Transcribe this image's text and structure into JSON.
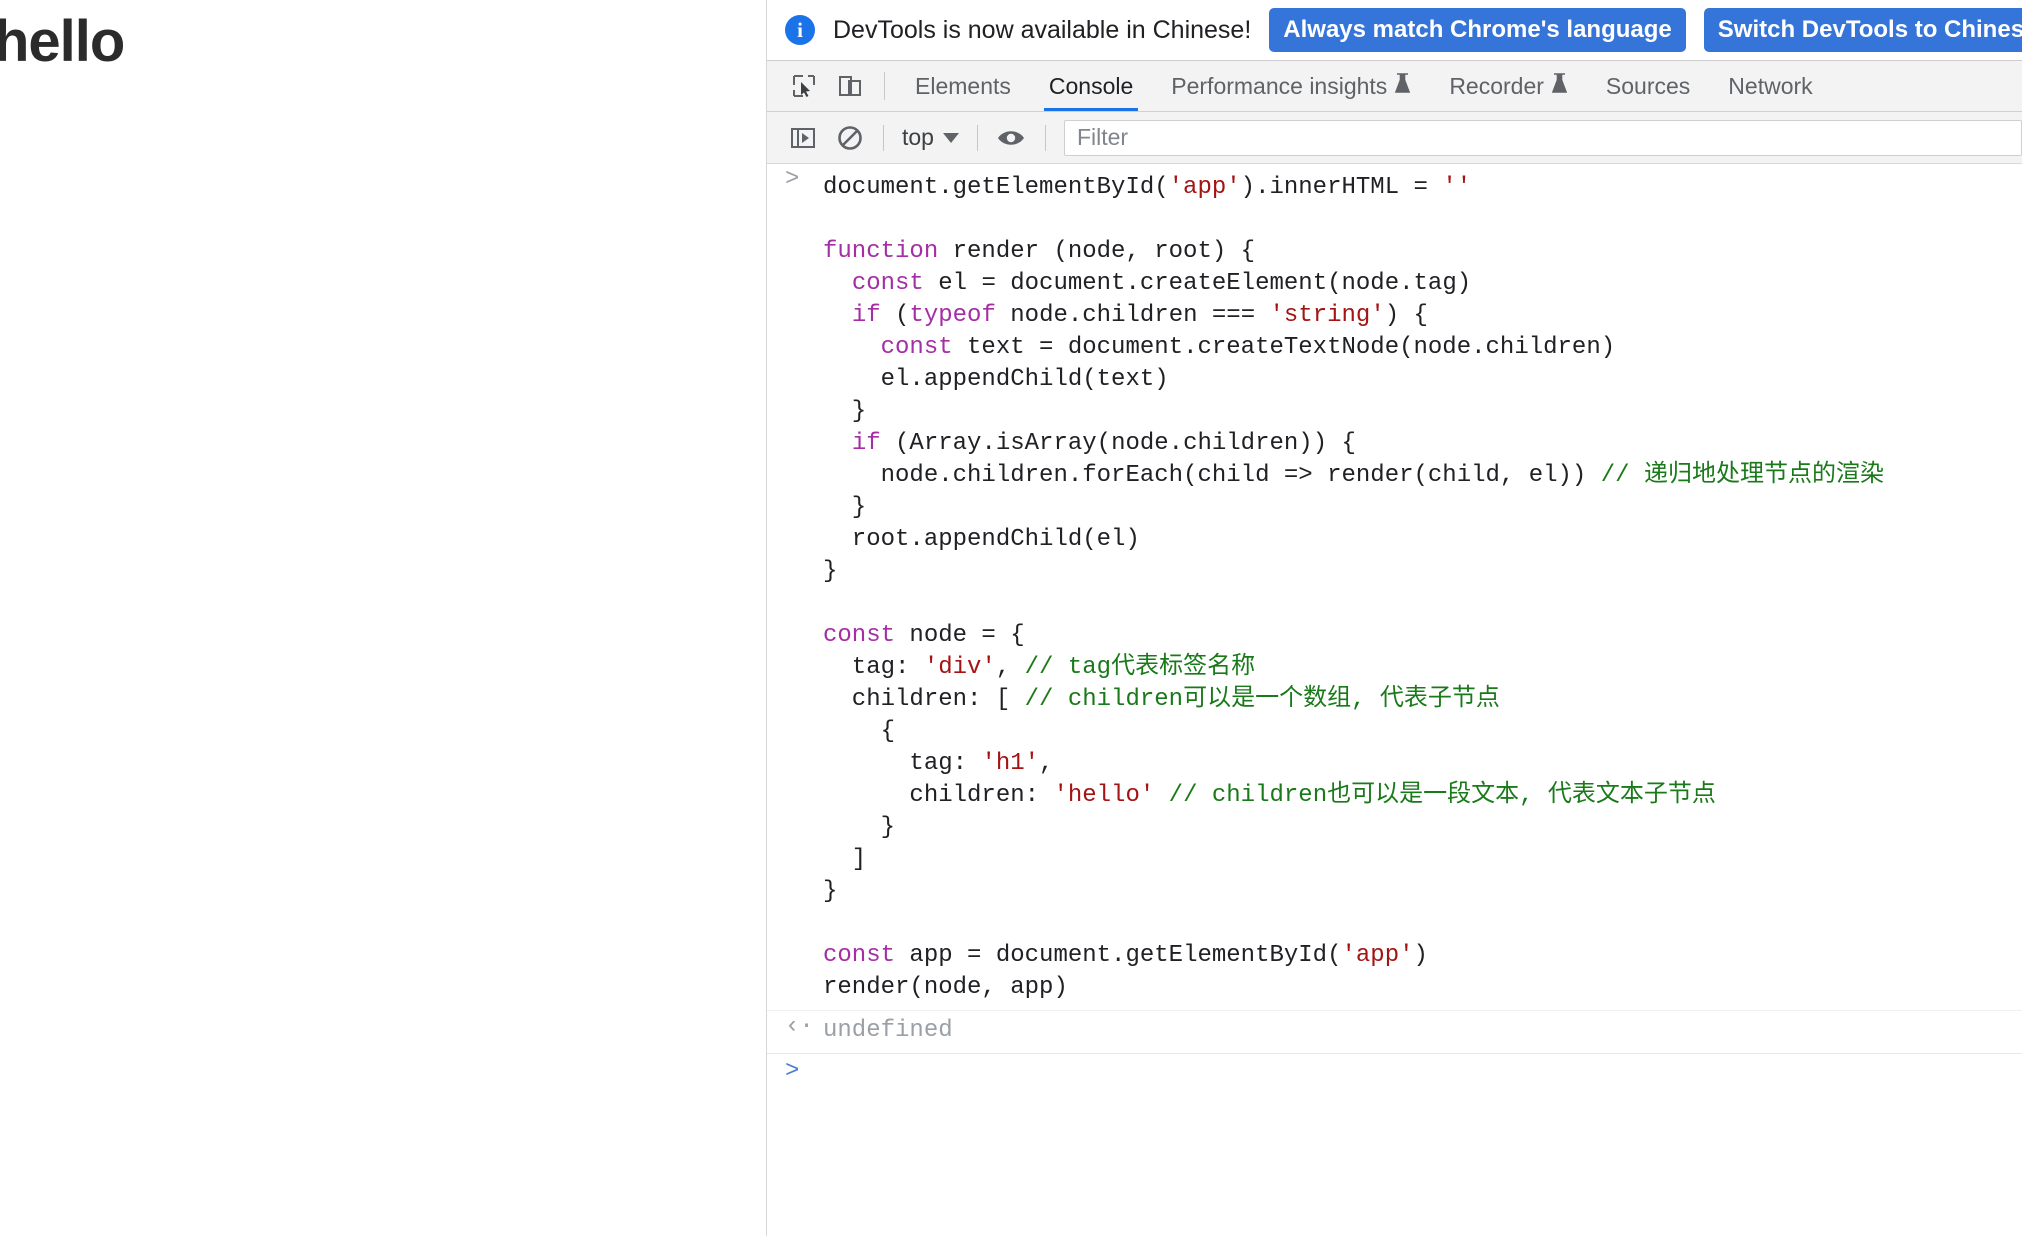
{
  "page": {
    "heading": "hello"
  },
  "colors": {
    "accent": "#1a73e8",
    "banner_button": "#3574d9",
    "keyword": "#a52ea5",
    "string": "#a31515",
    "comment": "#1a7a1a",
    "text": "#202124",
    "muted": "#9aa0a6"
  },
  "devtools": {
    "banner": {
      "icon": "info-icon",
      "message": "DevTools is now available in Chinese!",
      "buttons": [
        {
          "label": "Always match Chrome's language"
        },
        {
          "label": "Switch DevTools to Chinese"
        }
      ]
    },
    "tabbar": {
      "icons": [
        {
          "name": "inspect-element-icon"
        },
        {
          "name": "device-toolbar-icon"
        }
      ],
      "tabs": [
        {
          "label": "Elements",
          "active": false,
          "experimental": false
        },
        {
          "label": "Console",
          "active": true,
          "experimental": false
        },
        {
          "label": "Performance insights",
          "active": false,
          "experimental": true
        },
        {
          "label": "Recorder",
          "active": false,
          "experimental": true
        },
        {
          "label": "Sources",
          "active": false,
          "experimental": false
        },
        {
          "label": "Network",
          "active": false,
          "experimental": false
        }
      ]
    },
    "console_toolbar": {
      "sidebar_toggle": "console-sidebar-icon",
      "clear_console": "clear-console-icon",
      "context_selector": "top",
      "eye_toggle": "live-expression-eye-icon",
      "filter_placeholder": "Filter",
      "filter_value": ""
    },
    "console": {
      "input_prompt": ">",
      "result_prompt": "<",
      "result_value": "undefined",
      "next_prompt": ">",
      "code_lines": [
        [
          {
            "t": "document.getElementById(",
            "c": "pln"
          },
          {
            "t": "'app'",
            "c": "str"
          },
          {
            "t": ").innerHTML = ",
            "c": "pln"
          },
          {
            "t": "''",
            "c": "str"
          }
        ],
        [
          {
            "t": "",
            "c": "pln"
          }
        ],
        [
          {
            "t": "function",
            "c": "kw"
          },
          {
            "t": " render (node, root) {",
            "c": "pln"
          }
        ],
        [
          {
            "t": "  ",
            "c": "pln"
          },
          {
            "t": "const",
            "c": "kw"
          },
          {
            "t": " el = document.createElement(node.tag)",
            "c": "pln"
          }
        ],
        [
          {
            "t": "  ",
            "c": "pln"
          },
          {
            "t": "if",
            "c": "kw"
          },
          {
            "t": " (",
            "c": "pln"
          },
          {
            "t": "typeof",
            "c": "kw"
          },
          {
            "t": " node.children === ",
            "c": "pln"
          },
          {
            "t": "'string'",
            "c": "str"
          },
          {
            "t": ") {",
            "c": "pln"
          }
        ],
        [
          {
            "t": "    ",
            "c": "pln"
          },
          {
            "t": "const",
            "c": "kw"
          },
          {
            "t": " text = document.createTextNode(node.children)",
            "c": "pln"
          }
        ],
        [
          {
            "t": "    el.appendChild(text)",
            "c": "pln"
          }
        ],
        [
          {
            "t": "  }",
            "c": "pln"
          }
        ],
        [
          {
            "t": "  ",
            "c": "pln"
          },
          {
            "t": "if",
            "c": "kw"
          },
          {
            "t": " (Array.isArray(node.children)) {",
            "c": "pln"
          }
        ],
        [
          {
            "t": "    node.children.forEach(child => render(child, el)) ",
            "c": "pln"
          },
          {
            "t": "// 递归地处理节点的渲染",
            "c": "cmt"
          }
        ],
        [
          {
            "t": "  }",
            "c": "pln"
          }
        ],
        [
          {
            "t": "  root.appendChild(el)",
            "c": "pln"
          }
        ],
        [
          {
            "t": "}",
            "c": "pln"
          }
        ],
        [
          {
            "t": "",
            "c": "pln"
          }
        ],
        [
          {
            "t": "const",
            "c": "kw"
          },
          {
            "t": " node = {",
            "c": "pln"
          }
        ],
        [
          {
            "t": "  tag: ",
            "c": "pln"
          },
          {
            "t": "'div'",
            "c": "str"
          },
          {
            "t": ", ",
            "c": "pln"
          },
          {
            "t": "// tag代表标签名称",
            "c": "cmt"
          }
        ],
        [
          {
            "t": "  children: [ ",
            "c": "pln"
          },
          {
            "t": "// children可以是一个数组, 代表子节点",
            "c": "cmt"
          }
        ],
        [
          {
            "t": "    {",
            "c": "pln"
          }
        ],
        [
          {
            "t": "      tag: ",
            "c": "pln"
          },
          {
            "t": "'h1'",
            "c": "str"
          },
          {
            "t": ",",
            "c": "pln"
          }
        ],
        [
          {
            "t": "      children: ",
            "c": "pln"
          },
          {
            "t": "'hello'",
            "c": "str"
          },
          {
            "t": " ",
            "c": "pln"
          },
          {
            "t": "// children也可以是一段文本, 代表文本子节点",
            "c": "cmt"
          }
        ],
        [
          {
            "t": "    }",
            "c": "pln"
          }
        ],
        [
          {
            "t": "  ]",
            "c": "pln"
          }
        ],
        [
          {
            "t": "}",
            "c": "pln"
          }
        ],
        [
          {
            "t": "",
            "c": "pln"
          }
        ],
        [
          {
            "t": "const",
            "c": "kw"
          },
          {
            "t": " app = document.getElementById(",
            "c": "pln"
          },
          {
            "t": "'app'",
            "c": "str"
          },
          {
            "t": ")",
            "c": "pln"
          }
        ],
        [
          {
            "t": "render(node, app)",
            "c": "pln"
          }
        ]
      ]
    }
  }
}
